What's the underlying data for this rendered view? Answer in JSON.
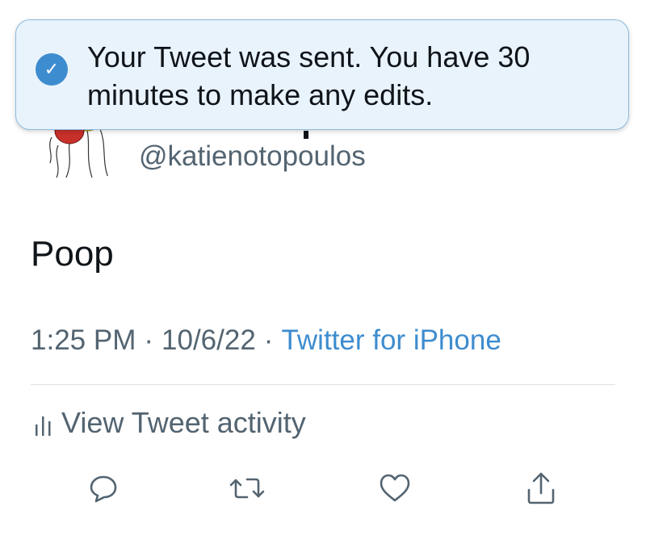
{
  "profile": {
    "handle": "@katienotopoulos"
  },
  "tweet": {
    "text": "Poop",
    "time": "1:25 PM",
    "separator_1": "·",
    "date": "10/6/22",
    "separator_2": "·",
    "source": "Twitter for iPhone"
  },
  "activity": {
    "label": "View Tweet activity",
    "icon": "bar-chart-icon"
  },
  "actions": [
    {
      "name": "reply",
      "icon": "reply-icon"
    },
    {
      "name": "retweet",
      "icon": "retweet-icon"
    },
    {
      "name": "like",
      "icon": "heart-icon"
    },
    {
      "name": "share",
      "icon": "share-icon"
    }
  ],
  "toast": {
    "icon": "check-icon",
    "check_glyph": "✓",
    "message": "Your Tweet was sent. You have 30 minutes to make any edits."
  },
  "colors": {
    "accent": "#3d8ccf",
    "text_secondary": "#536471",
    "toast_bg": "#e9f3fb",
    "toast_border": "#8cbce0"
  }
}
